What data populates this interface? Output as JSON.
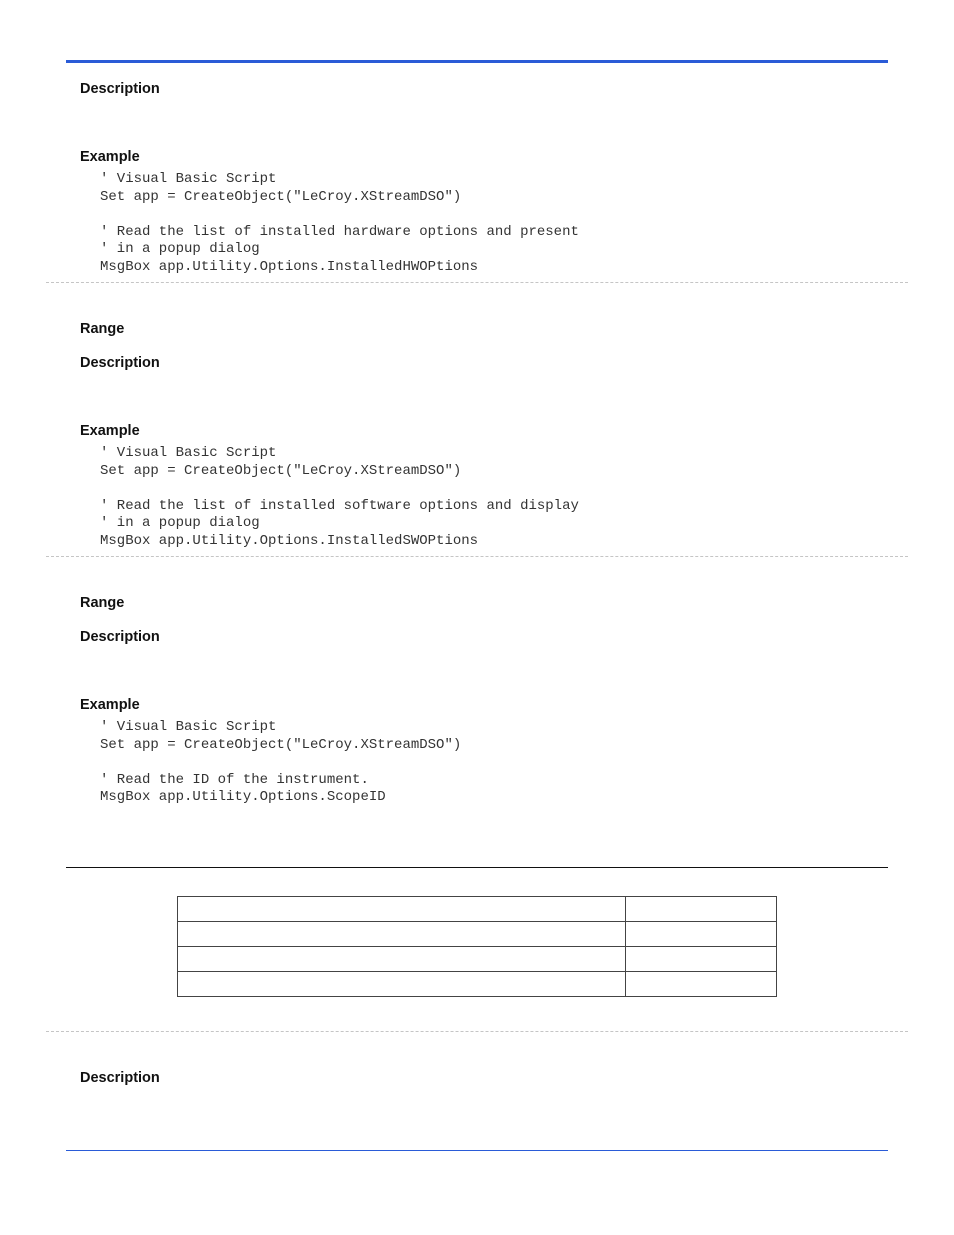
{
  "headings": {
    "description": "Description",
    "example": "Example",
    "range": "Range"
  },
  "block1": {
    "code": "' Visual Basic Script\nSet app = CreateObject(\"LeCroy.XStreamDSO\")\n\n' Read the list of installed hardware options and present\n' in a popup dialog\nMsgBox app.Utility.Options.InstalledHWOPtions"
  },
  "block2": {
    "code": "' Visual Basic Script\nSet app = CreateObject(\"LeCroy.XStreamDSO\")\n\n' Read the list of installed software options and display\n' in a popup dialog\nMsgBox app.Utility.Options.InstalledSWOPtions"
  },
  "block3": {
    "code": "' Visual Basic Script\nSet app = CreateObject(\"LeCroy.XStreamDSO\")\n\n' Read the ID of the instrument.\nMsgBox app.Utility.Options.ScopeID"
  }
}
